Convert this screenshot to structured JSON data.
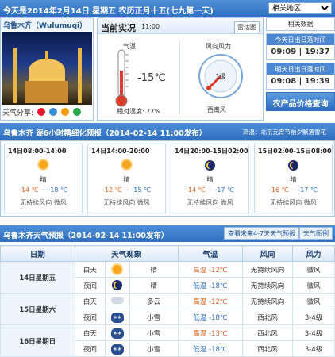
{
  "top": {
    "date_line": "今天是2014年2月14日 星期五 农历正月十五(七九第一天)",
    "region_select": "相关地区"
  },
  "city": {
    "name": "乌鲁木齐（Wulumuqi）",
    "share_label": "天气分享:"
  },
  "current": {
    "title": "当前实况",
    "time": "11:00",
    "radar_button": "雷达图",
    "temp_label": "气温",
    "temp_value": "-15℃",
    "humidity": "相对湿度: 77%",
    "wind_label": "风向风力",
    "wind_level": "1级",
    "wind_dir": "西南风"
  },
  "side": {
    "related": "相关数据",
    "today_label": "今天日出日落时间",
    "today_value": "09:09 | 19:37",
    "tomorrow_label": "明天日出日落时间",
    "tomorrow_value": "09:08 | 19:39",
    "price_button": "农产品价格查询"
  },
  "six_hour": {
    "title": "乌鲁木齐 逐6小时精细化预报（2014-02-14  11:00发布）",
    "right_note": "高温：北京元宵节前夕飘落雪花",
    "cards": [
      {
        "period": "14日08:00-14:00",
        "weather": "晴",
        "temp_hi": "-14 ℃",
        "temp_lo": "-18 ℃",
        "wind": "无持续风向  微风",
        "icon": "sun"
      },
      {
        "period": "14日14:00-20:00",
        "weather": "晴",
        "temp_hi": "-12 ℃",
        "temp_lo": "-15 ℃",
        "wind": "无持续风向  微风",
        "icon": "sun"
      },
      {
        "period": "14日20:00-15日02:00",
        "weather": "晴",
        "temp_hi": "-14 ℃",
        "temp_lo": "-17 ℃",
        "wind": "无持续风向  微风",
        "icon": "moon"
      },
      {
        "period": "15日02:00-15日08:00",
        "weather": "晴",
        "temp_hi": "-16 ℃",
        "temp_lo": "-17 ℃",
        "wind": "无持续风向  微风",
        "icon": "moon"
      }
    ]
  },
  "forecast": {
    "title": "乌鲁木齐天气预报（2014-02-14  11:00发布）",
    "btn_more": "查看未来4-7天天气预报",
    "btn_map": "天气图例",
    "headers": [
      "日期",
      "天气现象",
      "气温",
      "风向",
      "风力"
    ],
    "rows": [
      {
        "date": "14日星期五",
        "part": "白天",
        "icon": "sun",
        "weather": "晴",
        "temp_kind": "高温",
        "temp": "-12℃",
        "wind_dir": "无持续风向",
        "wind_pow": "微风"
      },
      {
        "date": "",
        "part": "夜间",
        "icon": "moon",
        "weather": "晴",
        "temp_kind": "低温",
        "temp": "-18℃",
        "wind_dir": "无持续风向",
        "wind_pow": "微风"
      },
      {
        "date": "15日星期六",
        "part": "白天",
        "icon": "cloud",
        "weather": "多云",
        "temp_kind": "高温",
        "temp": "-12℃",
        "wind_dir": "无持续风向",
        "wind_pow": "微风"
      },
      {
        "date": "",
        "part": "夜间",
        "icon": "snow",
        "weather": "小雪",
        "temp_kind": "低温",
        "temp": "-18℃",
        "wind_dir": "西北风",
        "wind_pow": "3-4级"
      },
      {
        "date": "16日星期日",
        "part": "白天",
        "icon": "snow",
        "weather": "小雪",
        "temp_kind": "高温",
        "temp": "-13℃",
        "wind_dir": "西北风",
        "wind_pow": "3-4级"
      },
      {
        "date": "",
        "part": "夜间",
        "icon": "snow",
        "weather": "小雪",
        "temp_kind": "低温",
        "temp": "-18℃",
        "wind_dir": "西北风",
        "wind_pow": "3-4级"
      }
    ]
  }
}
